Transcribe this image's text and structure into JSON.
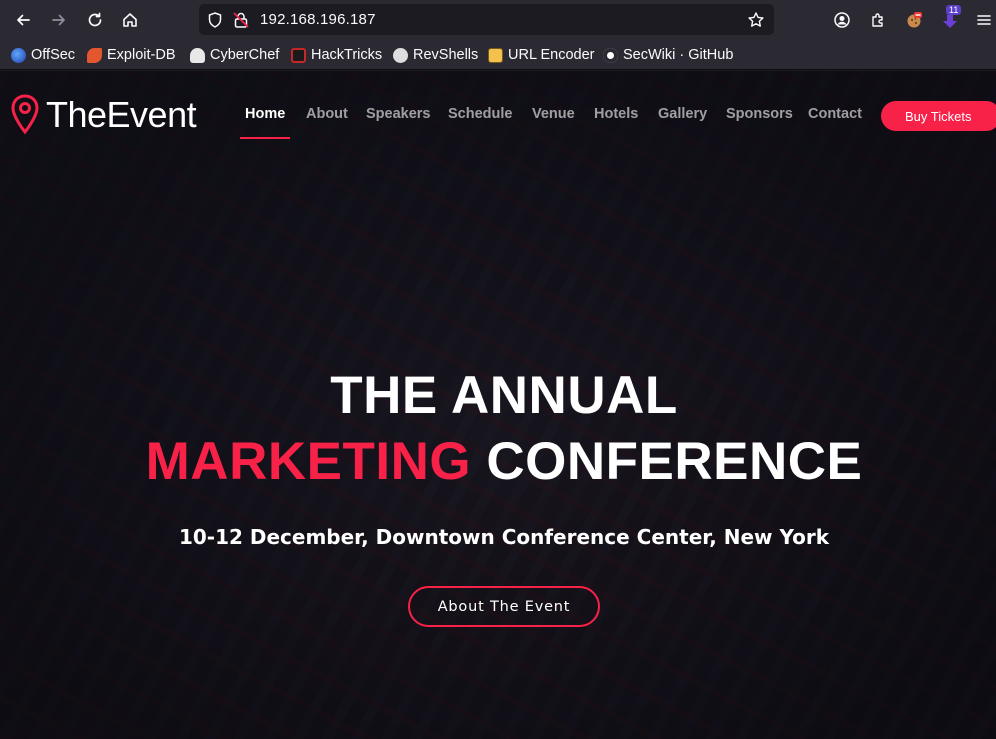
{
  "browser": {
    "url": "192.168.196.187",
    "extension_badge": "11",
    "bookmarks": [
      {
        "label": "OffSec",
        "icon": "offsec-icon",
        "color": "#3b82f6"
      },
      {
        "label": "Exploit-DB",
        "icon": "exploit-db-icon",
        "color": "#e4572e"
      },
      {
        "label": "CyberChef",
        "icon": "cyberchef-icon",
        "color": "#e8e8e8"
      },
      {
        "label": "HackTricks",
        "icon": "hacktricks-icon",
        "color": "#c62828"
      },
      {
        "label": "RevShells",
        "icon": "revshells-icon",
        "color": "#dddddd"
      },
      {
        "label": "URL Encoder",
        "icon": "url-encoder-icon",
        "color": "#f2c14e"
      },
      {
        "label": "SecWiki · GitHub",
        "icon": "github-icon",
        "color": "#ffffff"
      }
    ]
  },
  "site": {
    "logo_text": "TheEvent",
    "nav": [
      "Home",
      "About",
      "Speakers",
      "Schedule",
      "Venue",
      "Hotels",
      "Gallery",
      "Sponsors",
      "Contact"
    ],
    "active_nav": "Home",
    "cta": "Buy Tickets"
  },
  "hero": {
    "title_line1": "THE ANNUAL",
    "title_accent": "MARKETING",
    "title_rest": "CONFERENCE",
    "subtitle": "10-12 December, Downtown Conference Center, New York",
    "button": "About The Event"
  },
  "colors": {
    "accent": "#f82249",
    "browser_bg": "#2b2a33"
  }
}
